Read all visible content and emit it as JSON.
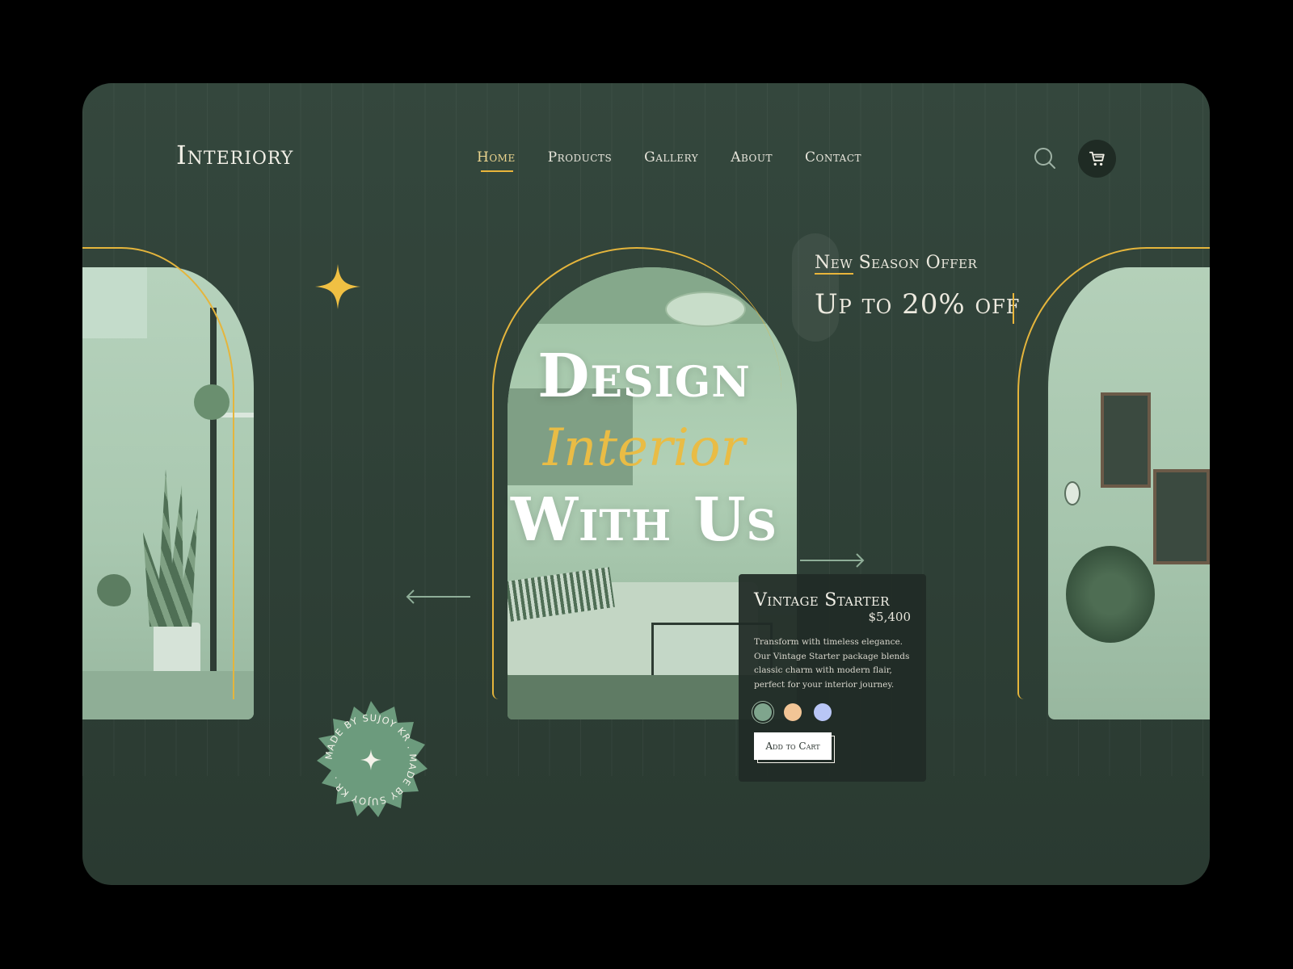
{
  "brand": {
    "logo": "Interiory"
  },
  "nav": {
    "items": [
      {
        "label": "Home",
        "active": true
      },
      {
        "label": "Products",
        "active": false
      },
      {
        "label": "Gallery",
        "active": false
      },
      {
        "label": "About",
        "active": false
      },
      {
        "label": "Contact",
        "active": false
      }
    ]
  },
  "header": {
    "search_icon": "search-icon",
    "cart_icon": "cart-icon"
  },
  "offer": {
    "label": "New Season Offer",
    "value": "Up to 20% off"
  },
  "hero": {
    "line1": "Design",
    "line2": "Interior",
    "line3": "With Us"
  },
  "product": {
    "title": "Vintage Starter",
    "price": "$5,400",
    "description": "Transform with timeless elegance. Our Vintage Starter package blends classic charm with modern flair, perfect for your interior journey.",
    "swatches": [
      "#7fa58d",
      "#f2c596",
      "#b9c6f6"
    ],
    "selected_swatch": 0,
    "cta": "Add to Cart"
  },
  "badge": {
    "text": "MADE BY SUJOY KR . MADE BY SUJOY KR . "
  },
  "colors": {
    "background": "#34473d",
    "accent": "#e9b53b",
    "text": "#f1efe6",
    "card": "#212c26"
  }
}
